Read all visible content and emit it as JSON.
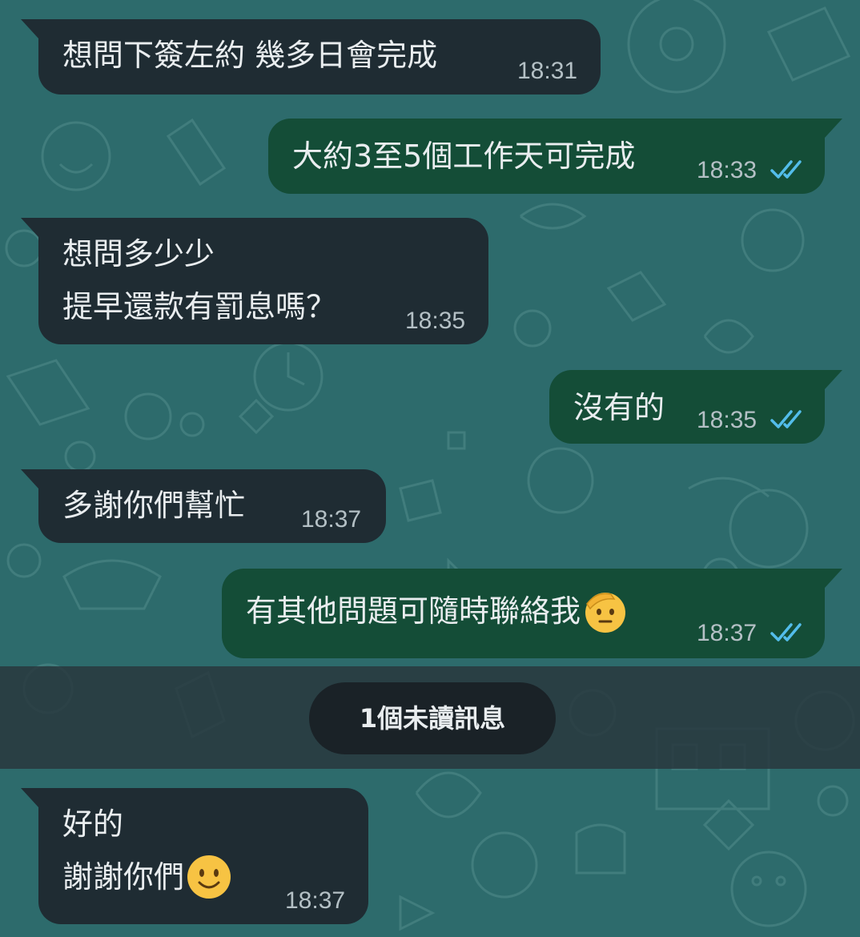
{
  "messages": [
    {
      "direction": "incoming",
      "lines": [
        "想問下簽左約 幾多日會完成"
      ],
      "time": "18:31"
    },
    {
      "direction": "outgoing",
      "lines": [
        "大約3至5個工作天可完成"
      ],
      "time": "18:33",
      "status": "read"
    },
    {
      "direction": "incoming",
      "lines": [
        "想問多少少",
        "提早還款有罰息嗎？"
      ],
      "time": "18:35"
    },
    {
      "direction": "outgoing",
      "lines": [
        "沒有的"
      ],
      "time": "18:35",
      "status": "read"
    },
    {
      "direction": "incoming",
      "lines": [
        "多謝你們幫忙"
      ],
      "time": "18:37"
    },
    {
      "direction": "outgoing",
      "lines": [
        "有其他問題可隨時聯絡我"
      ],
      "emoji": "saluting-face",
      "time": "18:37",
      "status": "read"
    },
    {
      "direction": "incoming",
      "lines": [
        "好的",
        "謝謝你們"
      ],
      "emoji": "smiling-face",
      "time": "18:37"
    }
  ],
  "unread_banner": {
    "label": "1個未讀訊息"
  },
  "colors": {
    "wallpaper": "#2d6b6c",
    "incoming_bubble": "#1f2c33",
    "outgoing_bubble": "#144d37",
    "read_ticks": "#53bdeb"
  }
}
